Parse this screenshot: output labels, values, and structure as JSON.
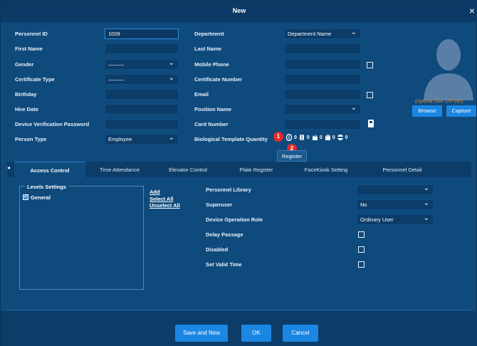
{
  "dialog": {
    "title": "New",
    "close_icon": "×"
  },
  "left_fields": [
    {
      "label": "Personnel ID",
      "value": "1009"
    },
    {
      "label": "First Name",
      "value": ""
    },
    {
      "label": "Gender",
      "value": "———"
    },
    {
      "label": "Certificate Type",
      "value": "———"
    },
    {
      "label": "Birthday",
      "value": ""
    },
    {
      "label": "Hire Date",
      "value": ""
    },
    {
      "label": "Device Verification Password",
      "value": ""
    },
    {
      "label": "Person Type",
      "value": "Employee"
    }
  ],
  "right_fields": [
    {
      "label": "Department",
      "value": "Department Name"
    },
    {
      "label": "Last Name",
      "value": ""
    },
    {
      "label": "Mobile Phone",
      "value": ""
    },
    {
      "label": "Certificate Number",
      "value": ""
    },
    {
      "label": "Email",
      "value": ""
    },
    {
      "label": "Position Name",
      "value": ""
    },
    {
      "label": "Card Number",
      "value": ""
    },
    {
      "label": "Biological Template Quantity",
      "value": ""
    }
  ],
  "bio_counts": [
    "0",
    "0",
    "0",
    "0",
    "0"
  ],
  "badges": {
    "one": "1",
    "two": "2"
  },
  "register_tooltip": "Register",
  "photo": {
    "hint": "(Optimal Size 120*140)",
    "browse": "Browse",
    "capture": "Capture"
  },
  "tabs": [
    "Access Control",
    "Time Attendance",
    "Elevator Control",
    "Plate Register",
    "FaceKiosk Setting",
    "Personnel Detail"
  ],
  "levels": {
    "title": "Levels Settings",
    "items": [
      "General"
    ],
    "add": "Add",
    "select_all": "Select All",
    "unselect_all": "Unselect All"
  },
  "access": [
    {
      "label": "Personnel Library",
      "value": ""
    },
    {
      "label": "Superuser",
      "value": "No"
    },
    {
      "label": "Device Operation Role",
      "value": "Ordinary User"
    },
    {
      "label": "Delay Passage",
      "value": ""
    },
    {
      "label": "Disabled",
      "value": ""
    },
    {
      "label": "Set Valid Time",
      "value": ""
    }
  ],
  "footer": {
    "save_new": "Save and New",
    "ok": "OK",
    "cancel": "Cancel"
  },
  "colors": {
    "accent": "#1c86e3",
    "background": "#0f4a7d",
    "hint": "#f28b1e",
    "badge": "#e32b2b"
  }
}
